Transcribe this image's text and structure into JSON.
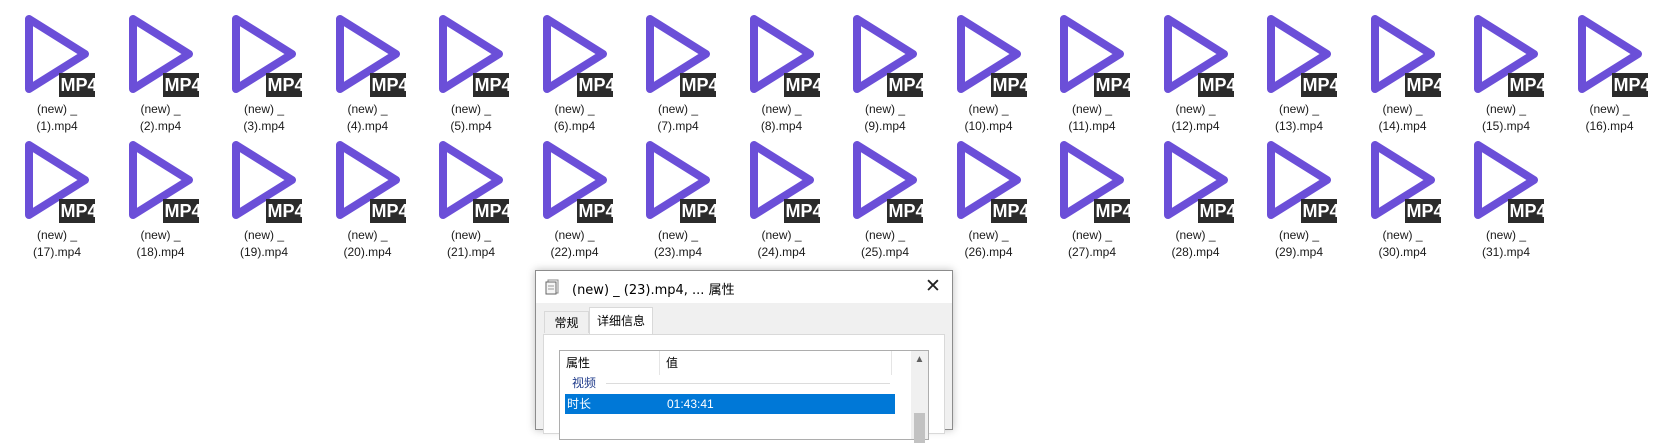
{
  "files": [
    {
      "line1": "(new) _",
      "line2": "(1).mp4"
    },
    {
      "line1": "(new) _",
      "line2": "(2).mp4"
    },
    {
      "line1": "(new) _",
      "line2": "(3).mp4"
    },
    {
      "line1": "(new) _",
      "line2": "(4).mp4"
    },
    {
      "line1": "(new) _",
      "line2": "(5).mp4"
    },
    {
      "line1": "(new) _",
      "line2": "(6).mp4"
    },
    {
      "line1": "(new) _",
      "line2": "(7).mp4"
    },
    {
      "line1": "(new) _",
      "line2": "(8).mp4"
    },
    {
      "line1": "(new) _",
      "line2": "(9).mp4"
    },
    {
      "line1": "(new) _",
      "line2": "(10).mp4"
    },
    {
      "line1": "(new) _",
      "line2": "(11).mp4"
    },
    {
      "line1": "(new) _",
      "line2": "(12).mp4"
    },
    {
      "line1": "(new) _",
      "line2": "(13).mp4"
    },
    {
      "line1": "(new) _",
      "line2": "(14).mp4"
    },
    {
      "line1": "(new) _",
      "line2": "(15).mp4"
    },
    {
      "line1": "(new) _",
      "line2": "(16).mp4"
    },
    {
      "line1": "(new) _",
      "line2": "(17).mp4"
    },
    {
      "line1": "(new) _",
      "line2": "(18).mp4"
    },
    {
      "line1": "(new) _",
      "line2": "(19).mp4"
    },
    {
      "line1": "(new) _",
      "line2": "(20).mp4"
    },
    {
      "line1": "(new) _",
      "line2": "(21).mp4"
    },
    {
      "line1": "(new) _",
      "line2": "(22).mp4"
    },
    {
      "line1": "(new) _",
      "line2": "(23).mp4"
    },
    {
      "line1": "(new) _",
      "line2": "(24).mp4"
    },
    {
      "line1": "(new) _",
      "line2": "(25).mp4"
    },
    {
      "line1": "(new) _",
      "line2": "(26).mp4"
    },
    {
      "line1": "(new) _",
      "line2": "(27).mp4"
    },
    {
      "line1": "(new) _",
      "line2": "(28).mp4"
    },
    {
      "line1": "(new) _",
      "line2": "(29).mp4"
    },
    {
      "line1": "(new) _",
      "line2": "(30).mp4"
    },
    {
      "line1": "(new) _",
      "line2": "(31).mp4"
    }
  ],
  "file_icon": {
    "name": "mp4-play-icon",
    "badge": "MP4",
    "accent": "#6b4fd8",
    "badge_bg": "#2b2b2b"
  },
  "dialog": {
    "title": "(new) _ (23).mp4, ... 属性",
    "title_icon": "properties-icon",
    "close_icon": "close-icon",
    "tabs": [
      {
        "label": "常规",
        "active": false
      },
      {
        "label": "详细信息",
        "active": true
      }
    ],
    "columns": {
      "property": "属性",
      "value": "值"
    },
    "group": "视频",
    "selected_row": {
      "key": "时长",
      "value": "01:43:41"
    },
    "selection_color": "#0078d7"
  }
}
